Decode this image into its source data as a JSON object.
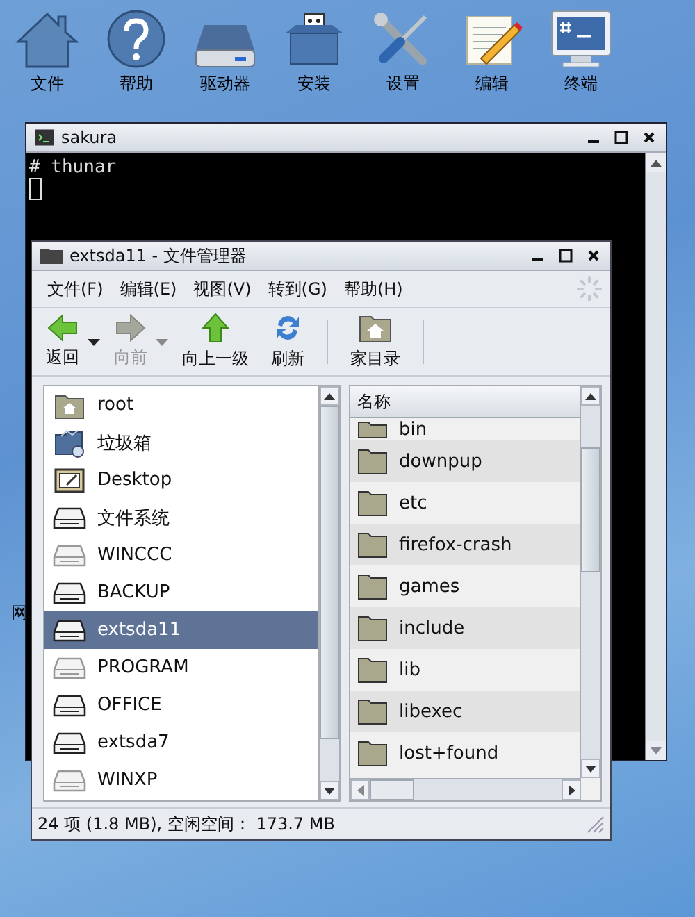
{
  "desktop_icons": [
    {
      "label": "文件",
      "kind": "home"
    },
    {
      "label": "帮助",
      "kind": "help"
    },
    {
      "label": "驱动器",
      "kind": "drive"
    },
    {
      "label": "安装",
      "kind": "package"
    },
    {
      "label": "设置",
      "kind": "tools"
    },
    {
      "label": "编辑",
      "kind": "editor"
    },
    {
      "label": "终端",
      "kind": "terminal"
    }
  ],
  "desktop_side_label": "网",
  "terminal": {
    "title": "sakura",
    "lines": [
      "# thunar"
    ]
  },
  "file_manager": {
    "title": "extsda11 - 文件管理器",
    "menu": [
      "文件(F)",
      "编辑(E)",
      "视图(V)",
      "转到(G)",
      "帮助(H)"
    ],
    "toolbar": [
      {
        "label": "返回",
        "kind": "back",
        "disabled": false,
        "dropdown": true
      },
      {
        "label": "向前",
        "kind": "forward",
        "disabled": true,
        "dropdown": true
      },
      {
        "label": "向上一级",
        "kind": "up",
        "disabled": false,
        "dropdown": false
      },
      {
        "label": "刷新",
        "kind": "refresh",
        "disabled": false,
        "dropdown": false
      },
      {
        "label": "家目录",
        "kind": "home",
        "disabled": false,
        "dropdown": false
      }
    ],
    "places": [
      {
        "label": "root",
        "kind": "home",
        "selected": false
      },
      {
        "label": "垃圾箱",
        "kind": "trash",
        "selected": false
      },
      {
        "label": "Desktop",
        "kind": "desktop",
        "selected": false
      },
      {
        "label": "文件系统",
        "kind": "drive",
        "mounted": true,
        "selected": false
      },
      {
        "label": "WINCCC",
        "kind": "drive",
        "mounted": false,
        "selected": false
      },
      {
        "label": "BACKUP",
        "kind": "drive",
        "mounted": true,
        "selected": false
      },
      {
        "label": "extsda11",
        "kind": "drive",
        "mounted": true,
        "selected": true
      },
      {
        "label": "PROGRAM",
        "kind": "drive",
        "mounted": false,
        "selected": false
      },
      {
        "label": "OFFICE",
        "kind": "drive",
        "mounted": true,
        "selected": false
      },
      {
        "label": "extsda7",
        "kind": "drive",
        "mounted": true,
        "selected": false
      },
      {
        "label": "WINXP",
        "kind": "drive",
        "mounted": false,
        "selected": false
      }
    ],
    "column_header": "名称",
    "files": [
      "bin",
      "downpup",
      "etc",
      "firefox-crash",
      "games",
      "include",
      "lib",
      "libexec",
      "lost+found"
    ],
    "status_bar": "24 项 (1.8 MB), 空闲空间： 173.7 MB"
  }
}
